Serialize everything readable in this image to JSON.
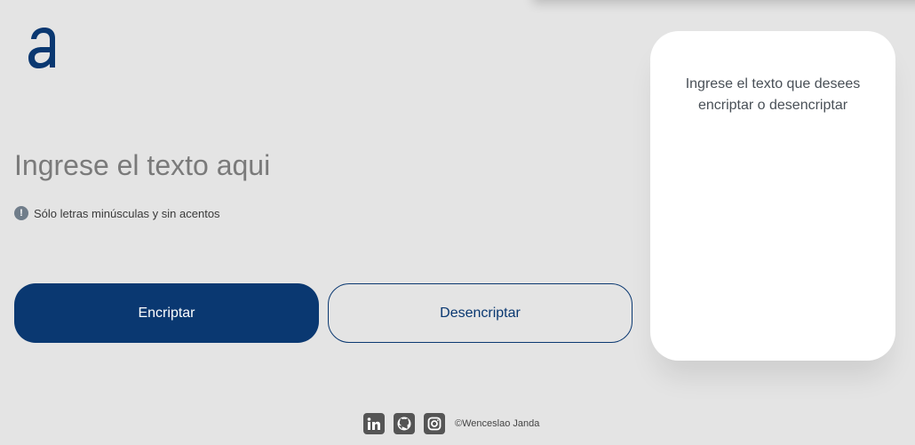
{
  "app": {
    "logo_letter": "a"
  },
  "input": {
    "placeholder": "Ingrese el texto aqui",
    "value": ""
  },
  "hint": {
    "icon": "exclamation-icon",
    "text": "Sólo letras minúsculas y sin acentos"
  },
  "buttons": {
    "encrypt_label": "Encriptar",
    "decrypt_label": "Desencriptar"
  },
  "output": {
    "message": "Ingrese el texto que desees encriptar o desencriptar"
  },
  "footer": {
    "social": [
      "linkedin-icon",
      "github-icon",
      "instagram-icon"
    ],
    "copyright": "©Wenceslao Janda"
  },
  "colors": {
    "background": "#e4e4e4",
    "primary": "#0a3871",
    "card": "#ffffff",
    "hint_icon": "#707d8a",
    "social_icon": "#555555"
  }
}
